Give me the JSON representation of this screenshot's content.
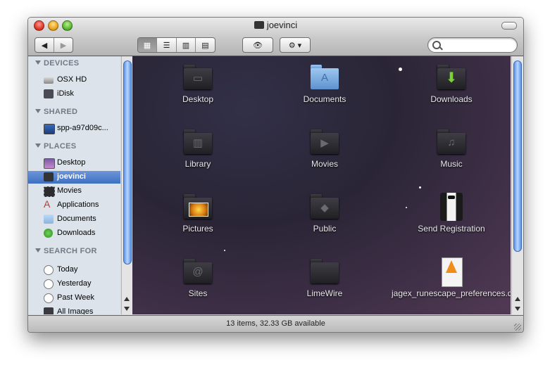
{
  "window": {
    "title": "joevinci",
    "status": "13 items, 32.33 GB available"
  },
  "toolbar": {
    "back_label": "◀",
    "forward_label": "▶",
    "view_icon": "▦",
    "view_list": "☰",
    "view_columns": "▥",
    "view_coverflow": "▤",
    "quicklook_label": "👁",
    "action_label": "⚙ ▾",
    "search_placeholder": ""
  },
  "sidebar": {
    "sections": [
      {
        "title": "DEVICES",
        "items": [
          {
            "label": "OSX HD",
            "icon": "hard-drive-icon"
          },
          {
            "label": "iDisk",
            "icon": "idisk-icon"
          }
        ]
      },
      {
        "title": "SHARED",
        "items": [
          {
            "label": "spp-a97d09c...",
            "icon": "network-computer-icon"
          }
        ]
      },
      {
        "title": "PLACES",
        "items": [
          {
            "label": "Desktop",
            "icon": "desktop-icon"
          },
          {
            "label": "joevinci",
            "icon": "home-icon",
            "selected": true
          },
          {
            "label": "Movies",
            "icon": "movies-icon"
          },
          {
            "label": "Applications",
            "icon": "applications-icon"
          },
          {
            "label": "Documents",
            "icon": "documents-icon"
          },
          {
            "label": "Downloads",
            "icon": "downloads-icon"
          }
        ]
      },
      {
        "title": "SEARCH FOR",
        "items": [
          {
            "label": "Today",
            "icon": "clock-icon"
          },
          {
            "label": "Yesterday",
            "icon": "clock-icon"
          },
          {
            "label": "Past Week",
            "icon": "clock-icon"
          },
          {
            "label": "All Images",
            "icon": "images-icon"
          }
        ]
      }
    ]
  },
  "files": [
    {
      "name": "Desktop",
      "icon": "desktop-folder-icon"
    },
    {
      "name": "Documents",
      "icon": "documents-folder-icon"
    },
    {
      "name": "Downloads",
      "icon": "downloads-folder-icon"
    },
    {
      "name": "Library",
      "icon": "library-folder-icon"
    },
    {
      "name": "Movies",
      "icon": "movies-folder-icon"
    },
    {
      "name": "Music",
      "icon": "music-folder-icon"
    },
    {
      "name": "Pictures",
      "icon": "pictures-folder-icon"
    },
    {
      "name": "Public",
      "icon": "public-folder-icon"
    },
    {
      "name": "Send Registration",
      "icon": "send-registration-icon"
    },
    {
      "name": "Sites",
      "icon": "sites-folder-icon"
    },
    {
      "name": "LimeWire",
      "icon": "limewire-folder-icon"
    },
    {
      "name": "jagex_runescape_preferences.dat",
      "icon": "dat-file-icon"
    }
  ]
}
